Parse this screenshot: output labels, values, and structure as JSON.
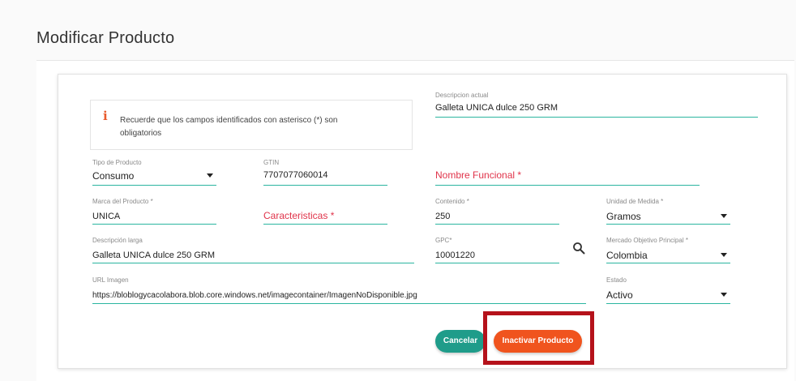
{
  "page": {
    "title": "Modificar Producto"
  },
  "info": {
    "icon": "info-icon",
    "message": "Recuerde que los campos identificados con asterisco (*) son obligatorios"
  },
  "fields": {
    "descripcion_actual": {
      "label": "Descripcion actual",
      "value": "Galleta UNICA dulce 250 GRM"
    },
    "tipo_producto": {
      "label": "Tipo de Producto",
      "value": "Consumo"
    },
    "gtin": {
      "label": "GTIN",
      "value": "7707077060014"
    },
    "nombre_funcional": {
      "label": "Nombre Funcional *"
    },
    "marca": {
      "label": "Marca del Producto *",
      "value": "UNICA"
    },
    "caracteristicas": {
      "label": "Caracteristicas *"
    },
    "contenido": {
      "label": "Contenido *",
      "value": "250"
    },
    "unidad_medida": {
      "label": "Unidad de Medida *",
      "value": "Gramos"
    },
    "descripcion_larga": {
      "label": "Descripción larga",
      "value": "Galleta UNICA dulce 250 GRM"
    },
    "gpc": {
      "label": "GPC*",
      "value": "10001220"
    },
    "mercado": {
      "label": "Mercado Objetivo Principal *",
      "value": "Colombia"
    },
    "url_imagen": {
      "label": "URL Imagen",
      "value": "https://bloblogycacolabora.blob.core.windows.net/imagecontainer/ImagenNoDisponible.jpg"
    },
    "estado": {
      "label": "Estado",
      "value": "Activo"
    }
  },
  "buttons": {
    "cancel": "Cancelar",
    "inactivate": "Inactivar Producto"
  },
  "colors": {
    "accent_line": "#2bb5a0",
    "cancel_button": "#1f9c8a",
    "inactivate_button": "#f0541e",
    "required_text": "#e0334a",
    "highlight_box": "#b5121b"
  }
}
